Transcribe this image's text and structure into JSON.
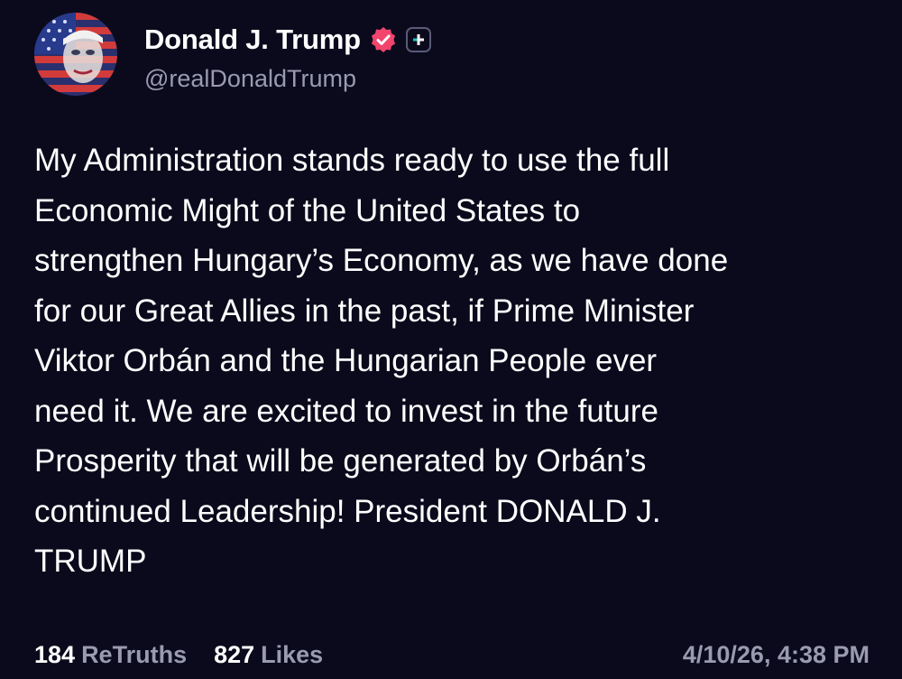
{
  "post": {
    "author": {
      "display_name": "Donald J. Trump",
      "handle": "@realDonaldTrump",
      "verified_icon": "verified-badge-icon",
      "subscription_icon": "plus-badge-icon"
    },
    "text": "My Administration stands ready to use the full\nEconomic Might of the United States to\nstrengthen Hungary’s Economy, as we have done\nfor our Great Allies in the past, if Prime Minister\nViktor Orbán and the Hungarian People ever\nneed it. We are excited to invest in the future\nProsperity that will be generated by Orbán’s\ncontinued Leadership! President DONALD J.\nTRUMP",
    "stats": {
      "retruths_count": "184",
      "retruths_label": "ReTruths",
      "likes_count": "827",
      "likes_label": "Likes"
    },
    "timestamp": "4/10/26, 4:38 PM"
  },
  "colors": {
    "background": "#0b0a1c",
    "text_primary": "#ffffff",
    "text_secondary": "#9a9bb0",
    "verified_badge": "#f2446d"
  }
}
